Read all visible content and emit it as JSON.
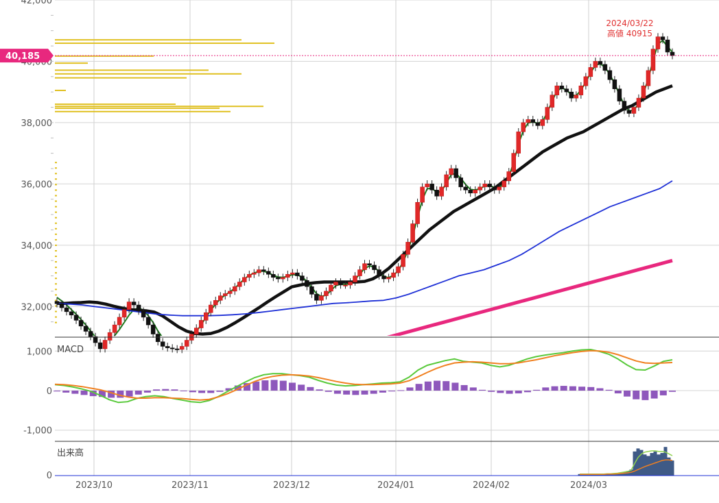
{
  "chart_data": [
    {
      "type": "candlestick",
      "panel": "price",
      "ylim": [
        31000,
        42000
      ],
      "y_ticks": [
        "42,000",
        "40,000",
        "38,000",
        "36,000",
        "34,000",
        "32,000"
      ],
      "y_tick_values": [
        42000,
        40000,
        38000,
        36000,
        34000,
        32000
      ],
      "x_ticks": [
        "2023/10",
        "2023/11",
        "2023/12",
        "2024/01",
        "2024/02",
        "2024/03"
      ],
      "current_price_label": "40,185",
      "current_price": 40185,
      "high_annotation": {
        "date": "2024/03/22",
        "label": "高値 40915",
        "value": 40915
      },
      "closes": [
        32090,
        31960,
        31830,
        31720,
        31550,
        31360,
        31190,
        31020,
        30820,
        30620,
        30900,
        31150,
        31400,
        31650,
        31900,
        32150,
        32050,
        31850,
        31650,
        31400,
        31100,
        30850,
        30700,
        30650,
        30620,
        30600,
        30700,
        30900,
        31100,
        31300,
        31550,
        31800,
        32050,
        32200,
        32350,
        32420,
        32500,
        32650,
        32800,
        32950,
        33050,
        33100,
        33200,
        33150,
        33050,
        32950,
        32900,
        32950,
        33050,
        33100,
        33000,
        32850,
        32650,
        32400,
        32200,
        32350,
        32500,
        32700,
        32800,
        32700,
        32700,
        32800,
        33000,
        33200,
        33400,
        33350,
        33200,
        33000,
        32900,
        32950,
        33100,
        33300,
        33700,
        34100,
        34700,
        35400,
        35900,
        36000,
        35800,
        35600,
        35900,
        36300,
        36500,
        36200,
        35900,
        35800,
        35700,
        35800,
        35900,
        36000,
        35900,
        35800,
        35900,
        36100,
        36400,
        37000,
        37700,
        38000,
        38100,
        38000,
        37900,
        38100,
        38500,
        38900,
        39200,
        39100,
        39000,
        38800,
        38900,
        39200,
        39500,
        39800,
        40000,
        39900,
        39700,
        39400,
        39100,
        38700,
        38400,
        38300,
        38500,
        38800,
        39200,
        39700,
        40400,
        40800,
        40700,
        40300,
        40185
      ],
      "series": [
        {
          "name": "",
          "color": "#1e7a1e",
          "values": [
            32300,
            32180,
            32050,
            31900,
            31750,
            31580,
            31400,
            31200,
            31000,
            30850,
            30830,
            30880,
            31050,
            31250,
            31480,
            31720,
            31900,
            31950,
            31880,
            31700,
            31480,
            31200,
            30980,
            30820,
            30700,
            30660,
            30700,
            30800,
            30980,
            31180,
            31400,
            31650,
            31880,
            32080,
            32250,
            32380,
            32480,
            32600,
            32750,
            32900,
            33020,
            33090,
            33150,
            33150,
            33100,
            33020,
            32960,
            32950,
            32990,
            33040,
            33030,
            32960,
            32820,
            32620,
            32420,
            32330,
            32370,
            32520,
            32680,
            32730,
            32720,
            32750,
            32880,
            33060,
            33240,
            33320,
            33290,
            33140,
            32980,
            32940,
            33020,
            33170,
            33460,
            33820,
            34300,
            34900,
            35480,
            35840,
            35860,
            35720,
            35760,
            36030,
            36300,
            36340,
            36180,
            35980,
            35820,
            35800,
            35850,
            35930,
            35950,
            35880,
            35880,
            36010,
            36240,
            36700,
            37300,
            37740,
            37990,
            38020,
            37980,
            38040,
            38330,
            38700,
            39030,
            39130,
            39070,
            38900,
            38880,
            39060,
            39330,
            39630,
            39870,
            39920,
            39800,
            39570,
            39270,
            38910,
            38580,
            38380,
            38410,
            38620,
            38960,
            39440,
            40040,
            40560,
            40680,
            40480,
            40300
          ]
        },
        {
          "name": "",
          "color": "#111111",
          "values": [
            32100,
            32100,
            32120,
            32130,
            32150,
            32130,
            32080,
            32010,
            31950,
            31900,
            31880,
            31860,
            31820,
            31700,
            31520,
            31340,
            31200,
            31120,
            31100,
            31120,
            31200,
            31320,
            31470,
            31630,
            31800,
            31970,
            32150,
            32320,
            32480,
            32640,
            32700,
            32750,
            32780,
            32800,
            32800,
            32800,
            32800,
            32800,
            32820,
            32900,
            33050,
            33250,
            33500,
            33750,
            34000,
            34250,
            34500,
            34700,
            34900,
            35100,
            35250,
            35400,
            35550,
            35700,
            35850,
            36050,
            36250,
            36450,
            36650,
            36850,
            37050,
            37200,
            37350,
            37500,
            37600,
            37700,
            37850,
            38000,
            38150,
            38300,
            38450,
            38550,
            38700,
            38850,
            39000,
            39100,
            39200
          ]
        },
        {
          "name": "",
          "color": "#1d2fd6",
          "values": [
            32100,
            32080,
            32050,
            32000,
            31950,
            31900,
            31850,
            31800,
            31750,
            31720,
            31700,
            31700,
            31700,
            31710,
            31730,
            31760,
            31800,
            31850,
            31900,
            31950,
            32000,
            32050,
            32100,
            32120,
            32150,
            32180,
            32200,
            32280,
            32400,
            32550,
            32700,
            32850,
            33000,
            33100,
            33200,
            33350,
            33500,
            33700,
            33950,
            34200,
            34450,
            34650,
            34850,
            35050,
            35250,
            35400,
            35550,
            35700,
            35850,
            36100
          ]
        },
        {
          "name": "",
          "color": "#e8287e",
          "values": [
            30800,
            30950,
            31100,
            31250,
            31400,
            31550,
            31700,
            31850,
            32000,
            32150,
            32300,
            32450,
            32600,
            32750,
            32900,
            33050,
            33200,
            33350,
            33500
          ]
        }
      ],
      "volume_profile_bars": [
        {
          "price": 40700,
          "length": 0.85
        },
        {
          "price": 40590,
          "length": 1.0
        },
        {
          "price": 40170,
          "length": 0.45
        },
        {
          "price": 39940,
          "length": 0.15
        },
        {
          "price": 39710,
          "length": 0.7
        },
        {
          "price": 39590,
          "length": 0.85
        },
        {
          "price": 39460,
          "length": 0.6
        },
        {
          "price": 39050,
          "length": 0.05
        },
        {
          "price": 38600,
          "length": 0.55
        },
        {
          "price": 38530,
          "length": 0.95
        },
        {
          "price": 38470,
          "length": 0.75
        },
        {
          "price": 38360,
          "length": 0.8
        }
      ]
    },
    {
      "type": "line",
      "panel": "macd",
      "label": "MACD",
      "ylim": [
        -1300,
        1300
      ],
      "y_ticks": [
        "1,000",
        "0",
        "-1,000"
      ],
      "y_tick_values": [
        1000,
        0,
        -1000
      ],
      "series": [
        {
          "name": "",
          "color": "#58c93a",
          "values": [
            150,
            130,
            90,
            40,
            -20,
            -120,
            -230,
            -300,
            -280,
            -200,
            -150,
            -130,
            -150,
            -200,
            -240,
            -280,
            -300,
            -250,
            -150,
            -20,
            100,
            220,
            330,
            400,
            430,
            430,
            400,
            380,
            340,
            260,
            190,
            140,
            120,
            130,
            150,
            170,
            190,
            200,
            220,
            340,
            520,
            640,
            700,
            760,
            800,
            740,
            720,
            700,
            640,
            600,
            640,
            720,
            800,
            860,
            900,
            930,
            960,
            1000,
            1030,
            1040,
            990,
            920,
            800,
            650,
            530,
            520,
            620,
            740,
            780
          ]
        },
        {
          "name": "",
          "color": "#f08020",
          "values": [
            160,
            150,
            130,
            100,
            60,
            20,
            -40,
            -110,
            -160,
            -190,
            -190,
            -180,
            -180,
            -190,
            -200,
            -220,
            -240,
            -220,
            -160,
            -80,
            20,
            130,
            230,
            310,
            360,
            390,
            400,
            390,
            370,
            330,
            280,
            230,
            190,
            160,
            150,
            150,
            160,
            170,
            190,
            250,
            350,
            460,
            560,
            640,
            700,
            720,
            730,
            720,
            700,
            680,
            680,
            700,
            740,
            780,
            830,
            880,
            920,
            960,
            990,
            1010,
            1000,
            970,
            910,
            830,
            750,
            700,
            690,
            700,
            710
          ]
        }
      ],
      "histogram": [
        -20,
        -50,
        -80,
        -110,
        -140,
        -160,
        -180,
        -180,
        -150,
        -100,
        -50,
        30,
        40,
        30,
        -10,
        -40,
        -60,
        -60,
        -30,
        60,
        130,
        190,
        230,
        260,
        270,
        250,
        200,
        150,
        90,
        30,
        -30,
        -80,
        -100,
        -110,
        -100,
        -80,
        -50,
        -20,
        10,
        80,
        170,
        230,
        250,
        240,
        200,
        140,
        80,
        20,
        -30,
        -60,
        -80,
        -70,
        -40,
        20,
        80,
        110,
        120,
        110,
        100,
        90,
        60,
        20,
        -70,
        -150,
        -220,
        -240,
        -200,
        -120,
        -30
      ]
    },
    {
      "type": "bar",
      "panel": "volume",
      "label": "出来高",
      "y_ticks": [
        "0"
      ],
      "y_tick_values": [
        0
      ],
      "values": [
        0.05,
        0.05,
        0.05,
        0.05,
        0.05,
        0.05,
        0.05,
        0.05,
        0.06,
        0.06,
        0.07,
        0.08,
        0.1,
        0.12,
        0.15,
        0.2,
        0.8,
        0.9,
        0.85,
        0.7,
        0.65,
        0.75,
        0.8,
        0.7,
        0.75,
        0.95,
        0.6,
        0.5
      ],
      "series": [
        {
          "name": "",
          "color": "#8fd14f",
          "values": [
            0.05,
            0.05,
            0.05,
            0.05,
            0.05,
            0.05,
            0.05,
            0.05,
            0.06,
            0.06,
            0.07,
            0.08,
            0.1,
            0.12,
            0.14,
            0.18,
            0.4,
            0.6,
            0.72,
            0.78,
            0.8,
            0.82,
            0.82,
            0.8,
            0.8,
            0.78,
            0.72,
            0.66
          ]
        },
        {
          "name": "",
          "color": "#f08020",
          "values": [
            0.04,
            0.04,
            0.04,
            0.04,
            0.04,
            0.04,
            0.04,
            0.04,
            0.05,
            0.05,
            0.05,
            0.06,
            0.07,
            0.08,
            0.09,
            0.11,
            0.15,
            0.2,
            0.25,
            0.3,
            0.34,
            0.38,
            0.42,
            0.46,
            0.5,
            0.52,
            0.52,
            0.5
          ]
        }
      ]
    }
  ]
}
